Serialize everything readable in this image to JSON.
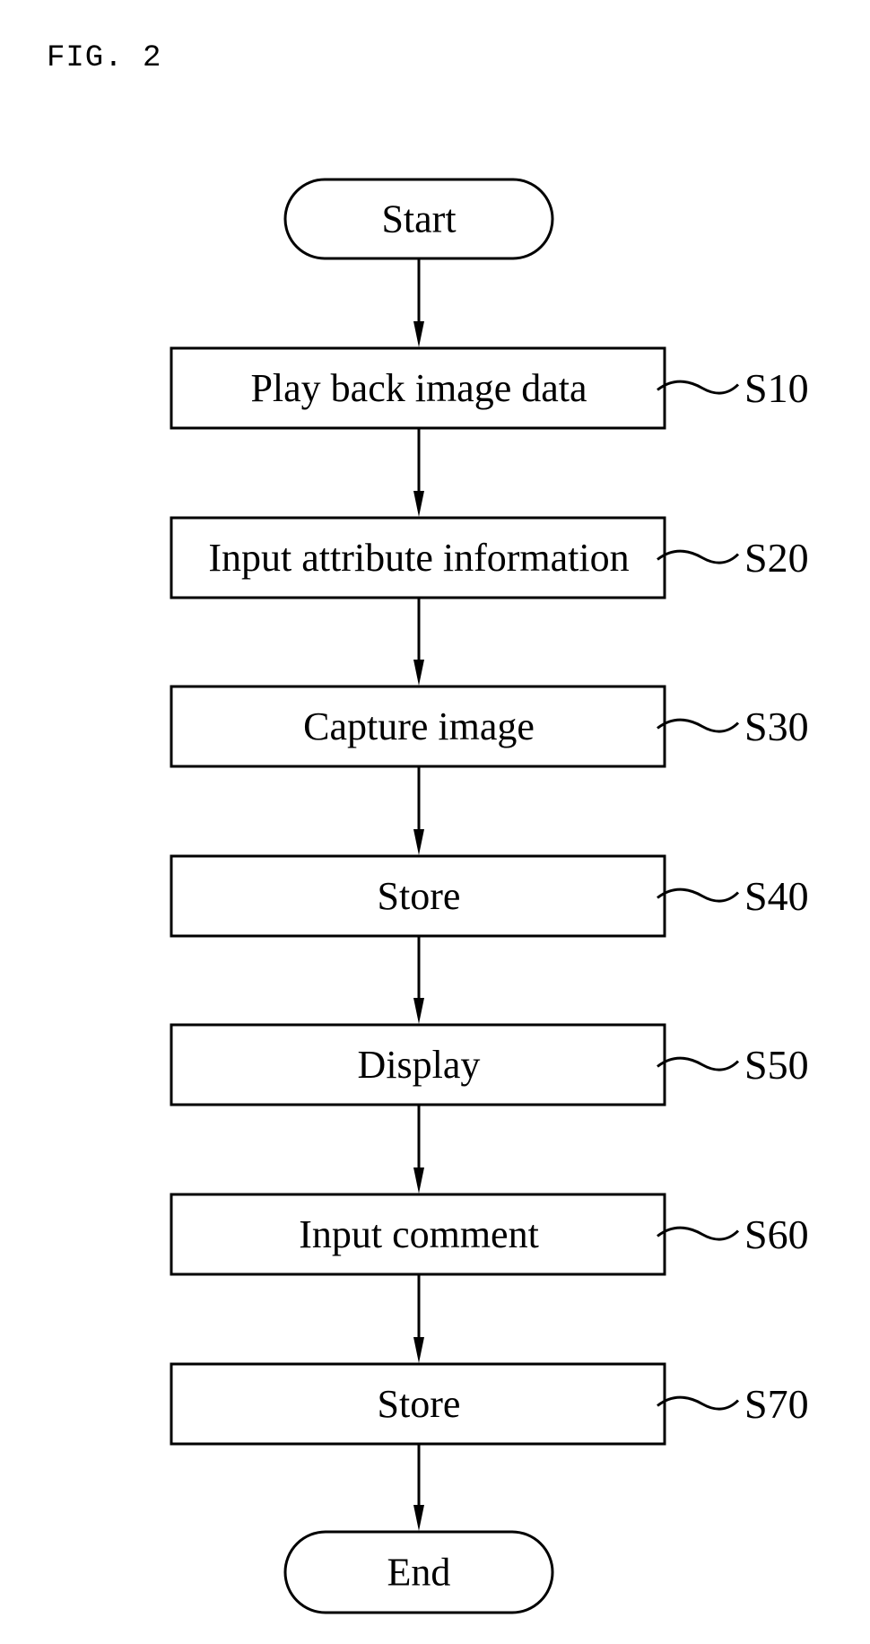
{
  "figure": {
    "label": "FIG. 2"
  },
  "flowchart": {
    "start": {
      "label": "Start"
    },
    "steps": [
      {
        "id": "S10",
        "label": "Play back image data"
      },
      {
        "id": "S20",
        "label": "Input attribute information"
      },
      {
        "id": "S30",
        "label": "Capture image"
      },
      {
        "id": "S40",
        "label": "Store"
      },
      {
        "id": "S50",
        "label": "Display"
      },
      {
        "id": "S60",
        "label": "Input comment"
      },
      {
        "id": "S70",
        "label": "Store"
      }
    ],
    "end": {
      "label": "End"
    }
  }
}
